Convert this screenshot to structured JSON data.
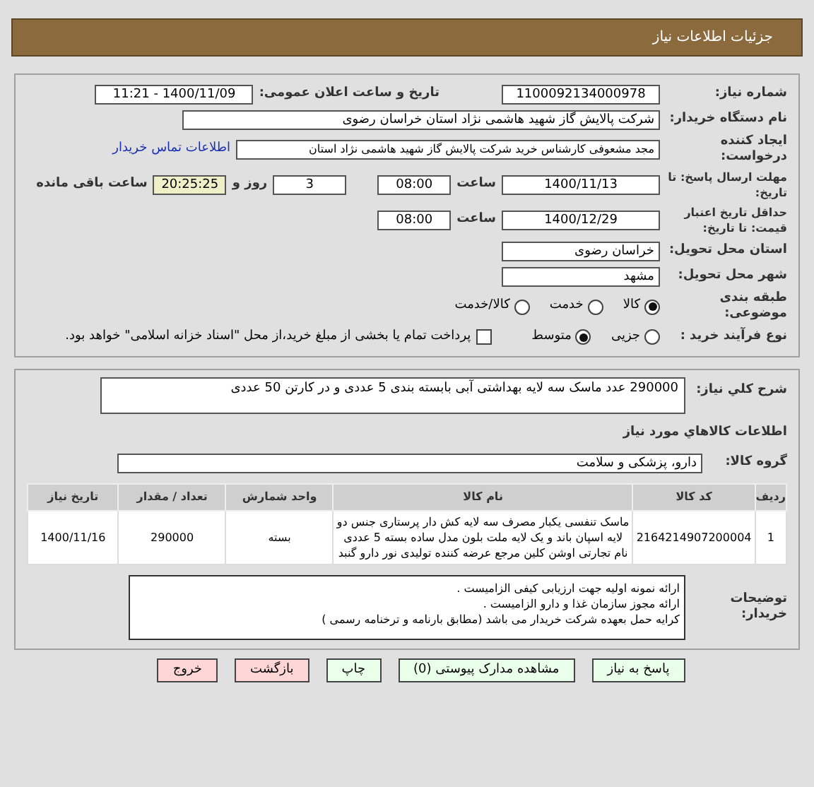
{
  "header": {
    "title": "جزئیات اطلاعات نیاز"
  },
  "need_number": {
    "label": "شماره نیاز:",
    "value": "1100092134000978"
  },
  "announce": {
    "label": "تاریخ و ساعت اعلان عمومی:",
    "value": "1400/11/09 - 11:21"
  },
  "buyer": {
    "label": "نام دستگاه خریدار:",
    "value": "شرکت پالایش گاز شهید هاشمی نژاد   استان خراسان رضوی"
  },
  "creator": {
    "label": "ایجاد کننده درخواست:",
    "value": "مجد مشعوفی کارشناس خرید شرکت پالایش گاز شهید هاشمی نژاد   استان",
    "link": "اطلاعات تماس خریدار"
  },
  "deadline": {
    "label": "مهلت ارسال پاسخ: تا تاریخ:",
    "date": "1400/11/13",
    "time_label": "ساعت",
    "time": "08:00",
    "days": "3",
    "days_label": "روز و",
    "remaining": "20:25:25",
    "remaining_label": "ساعت باقی مانده"
  },
  "validity": {
    "label": "حداقل تاریخ اعتبار قیمت: تا تاریخ:",
    "date": "1400/12/29",
    "time_label": "ساعت",
    "time": "08:00"
  },
  "province": {
    "label": "استان محل تحویل:",
    "value": "خراسان رضوی"
  },
  "city": {
    "label": "شهر محل تحویل:",
    "value": "مشهد"
  },
  "category": {
    "label": "طبقه بندی موضوعی:",
    "options": [
      {
        "label": "کالا",
        "selected": true
      },
      {
        "label": "خدمت",
        "selected": false
      },
      {
        "label": "کالا/خدمت",
        "selected": false
      }
    ]
  },
  "process": {
    "label": "نوع فرآیند خرید :",
    "options": [
      {
        "label": "جزیی",
        "selected": false
      },
      {
        "label": "متوسط",
        "selected": true
      }
    ],
    "treasury": {
      "label": "پرداخت تمام یا بخشی از مبلغ خرید،از محل \"اسناد خزانه اسلامی\" خواهد بود.",
      "checked": false
    }
  },
  "description": {
    "label": "شرح کلي نیاز:",
    "value": "290000 عدد ماسک سه لایه بهداشتی آبی بابسته بندی 5 عددی و در کارتن 50 عددی"
  },
  "goods_heading": "اطلاعات کالاهاي مورد نیاز",
  "goods_group": {
    "label": "گروه کالا:",
    "value": "دارو، پزشکی و سلامت"
  },
  "table": {
    "columns": [
      "ردیف",
      "کد کالا",
      "نام کالا",
      "واحد شمارش",
      "تعداد / مقدار",
      "تاریخ نیاز"
    ],
    "rows": [
      [
        "1",
        "2164214907200004",
        "ماسک تنفسی یکبار مصرف سه لایه کش دار پرستاری جنس دو لایه اسپان باند و یک لایه ملت بلون مدل ساده بسته 5 عددی نام تجارتی اوشن کلین مرجع عرضه کننده تولیدی نور دارو گنبد",
        "بسته",
        "290000",
        "1400/11/16"
      ]
    ]
  },
  "notes": {
    "label": "توضیحات خریدار:",
    "lines": [
      "ارائه نمونه اولیه جهت ارزیابی کیفی الزامیست .",
      "ارائه مجوز سازمان غذا و دارو الزامیست .",
      "کرایه حمل بعهده شرکت خریدار می باشد (مطابق بارنامه و ترخنامه رسمی )"
    ]
  },
  "buttons": [
    {
      "label": "پاسخ به نیاز",
      "kind": "green"
    },
    {
      "label": "مشاهده مدارک پیوستی (0)",
      "kind": "green"
    },
    {
      "label": "چاپ",
      "kind": "green"
    },
    {
      "label": "بازگشت",
      "kind": "red"
    },
    {
      "label": "خروج",
      "kind": "red"
    }
  ]
}
